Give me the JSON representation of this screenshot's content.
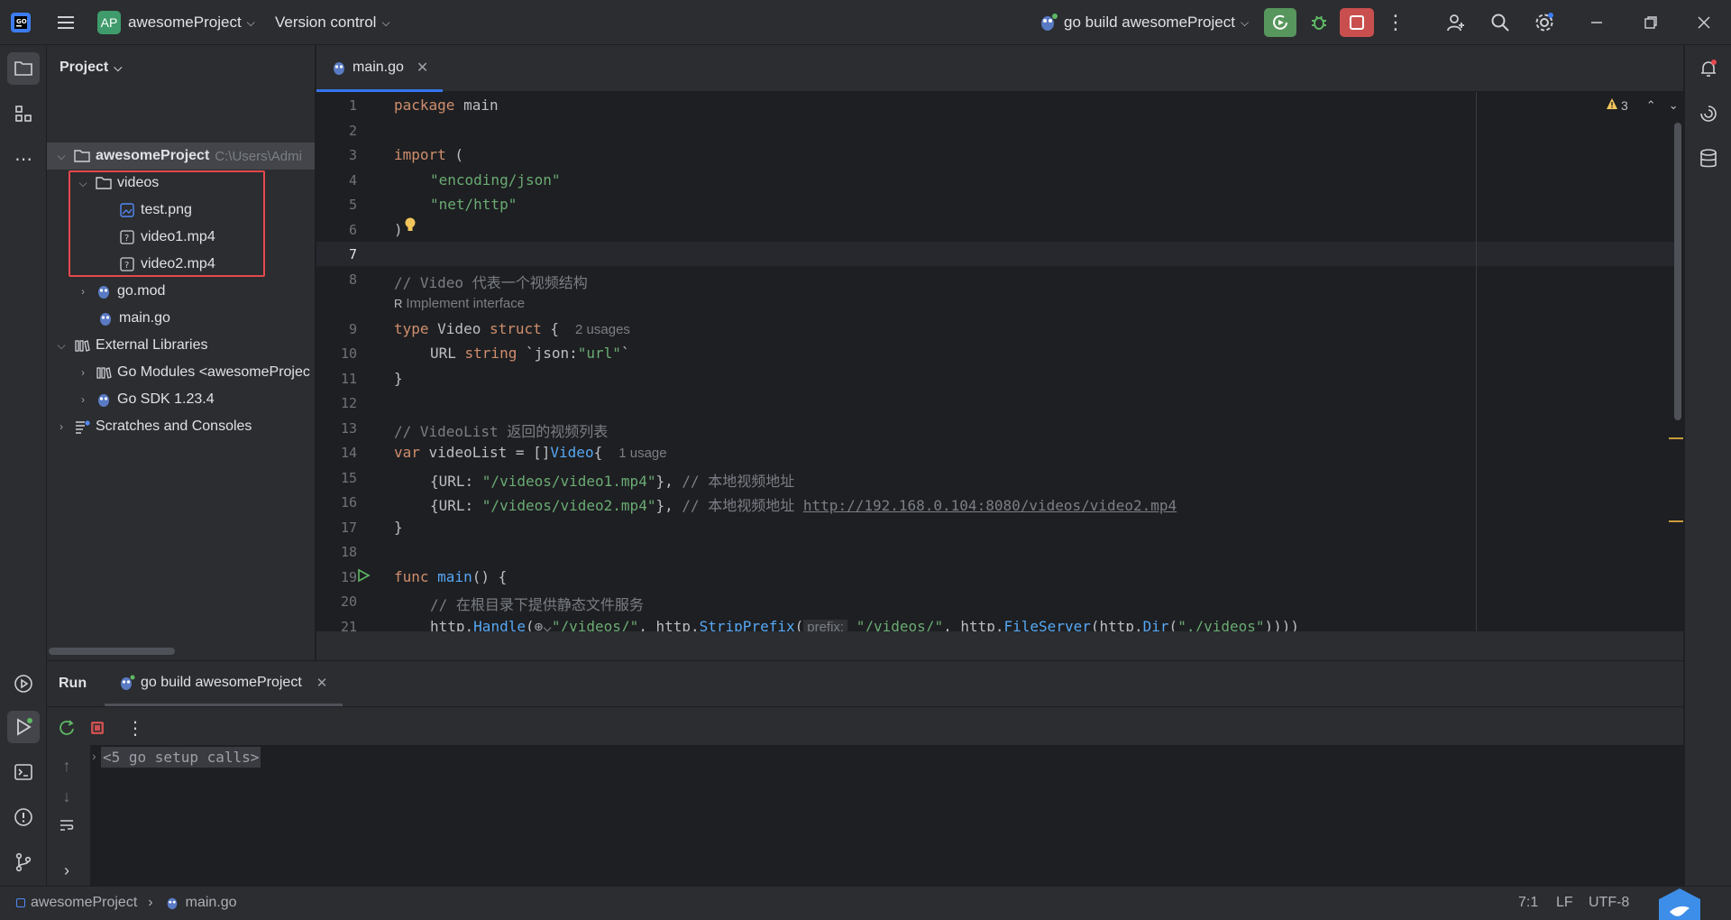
{
  "titlebar": {
    "logo_initials": "AP",
    "project_name": "awesomeProject",
    "version_control": "Version control",
    "run_config": "go build awesomeProject"
  },
  "project_panel": {
    "title": "Project",
    "root_name": "awesomeProject",
    "root_path": "C:\\Users\\Admi",
    "items": [
      {
        "label": "videos"
      },
      {
        "label": "test.png"
      },
      {
        "label": "video1.mp4"
      },
      {
        "label": "video2.mp4"
      },
      {
        "label": "go.mod"
      },
      {
        "label": "main.go"
      },
      {
        "label": "External Libraries"
      },
      {
        "label": "Go Modules <awesomeProjec"
      },
      {
        "label": "Go SDK 1.23.4"
      },
      {
        "label": "Scratches and Consoles"
      }
    ],
    "highlight_color": "#e5484d"
  },
  "editor": {
    "tab_label": "main.go",
    "warnings_count": "3",
    "line_numbers": [
      "1",
      "2",
      "3",
      "4",
      "5",
      "6",
      "7",
      "8",
      "9",
      "10",
      "11",
      "12",
      "13",
      "14",
      "15",
      "16",
      "17",
      "18",
      "19",
      "20",
      "21"
    ],
    "lines": {
      "l1_kw": "package",
      "l1_rest": " main",
      "l3_kw": "import",
      "l3_rest": " (",
      "l4": "\"encoding/json\"",
      "l5": "\"net/http\"",
      "l6": ")",
      "l8": "// Video 代表一个视频结构",
      "l8_hint": "Implement interface",
      "l9_kw": "type",
      "l9_name": " Video ",
      "l9_kw2": "struct",
      "l9_rest": " {",
      "l9_hint": "2 usages",
      "l10_a": "URL ",
      "l10_kw": "string",
      "l10_tag1": " `json:",
      "l10_tag2": "\"url\"",
      "l10_tag3": "`",
      "l11": "}",
      "l13": "// VideoList 返回的视频列表",
      "l14_kw": "var",
      "l14_rest": " videoList = []",
      "l14_type": "Video",
      "l14_brace": "{",
      "l14_hint": "1 usage",
      "l15_a": "{URL: ",
      "l15_str": "\"/videos/video1.mp4\"",
      "l15_b": "}, ",
      "l15_cm": "// 本地视频地址",
      "l16_a": "{URL: ",
      "l16_str": "\"/videos/video2.mp4\"",
      "l16_b": "}, ",
      "l16_cm": "// 本地视频地址 ",
      "l16_link": "http://192.168.0.104:8080/videos/video2.mp4",
      "l17": "}",
      "l19_kw": "func",
      "l19_fn": " main",
      "l19_rest": "() {",
      "l20": "// 在根目录下提供静态文件服务",
      "l21_a": "http.",
      "l21_fn": "Handle",
      "l21_b": "(",
      "l21_str1": "\"/videos/\"",
      "l21_c": ", http.",
      "l21_fn2": "StripPrefix",
      "l21_d": "(",
      "l21_param": "prefix:",
      "l21_str2": " \"/videos/\"",
      "l21_e": ", http.",
      "l21_fn3": "FileServer",
      "l21_f": "(http.",
      "l21_fn4": "Dir",
      "l21_g": "(",
      "l21_str3": "\"./videos\"",
      "l21_h": "))))"
    }
  },
  "run_panel": {
    "title": "Run",
    "tab_label": "go build awesomeProject",
    "console_line": "<5 go setup calls>"
  },
  "statusbar": {
    "breadcrumb_project": "awesomeProject",
    "breadcrumb_file": "main.go",
    "position": "7:1",
    "line_ending": "LF",
    "encoding": "UTF-8"
  }
}
